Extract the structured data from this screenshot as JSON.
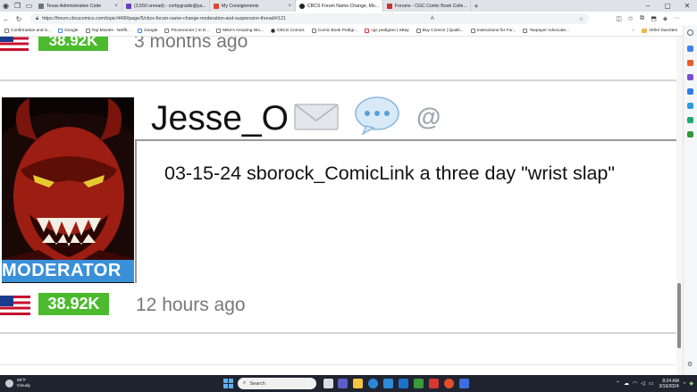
{
  "browser": {
    "tabs": [
      {
        "label": "Texas Administrative Code",
        "fav_color": "#6a7380"
      },
      {
        "label": "(3,550 unread) - corbygradis@ya...",
        "fav_color": "#6a3fb5"
      },
      {
        "label": "My Consignments",
        "fav_color": "#e0462f"
      },
      {
        "label": "CBCS Forum Name Change, Mo...",
        "fav_color": "#222222"
      },
      {
        "label": "Forums - CGC Comic Book Colle...",
        "fav_color": "#c9302c"
      }
    ],
    "url": "https://forum.cbcscomics.com/topic/4490/page/5/cbcs-forum-name-change-moderation-and-suspension-thread/#121",
    "favorites": [
      {
        "label": "Confirmation and S..."
      },
      {
        "label": "Google"
      },
      {
        "label": "Top Movies - Netfli..."
      },
      {
        "label": "Google"
      },
      {
        "label": "Pricenomics | In D..."
      },
      {
        "label": "Mike's Amazing Wo..."
      },
      {
        "label": "CBCS Comics"
      },
      {
        "label": "Comic Book Pedigr..."
      },
      {
        "label": "cgc pedigree | eBay"
      },
      {
        "label": "Buy Comics | Qualit..."
      },
      {
        "label": "Instructions for For..."
      },
      {
        "label": "Taxpayer Advocate..."
      }
    ],
    "other_favorites": "Other favorites"
  },
  "posts": {
    "prev": {
      "rep": "38.92K",
      "time": "3 months ago"
    },
    "current": {
      "username": "Jesse_O",
      "role_badge": "MODERATOR",
      "content": "03-15-24 sborock_ComicLink a three day \"wrist slap\"",
      "rep": "38.92K",
      "time": "12 hours ago",
      "mention_icon": "@"
    }
  },
  "taskbar": {
    "weather_temp": "65°F",
    "weather_desc": "Cloudy",
    "search_placeholder": "Search",
    "time": "8:24 AM",
    "date": "3/16/2024"
  },
  "colors": {
    "rep_green": "#4cba2e",
    "mod_blue": "#3a8fd9",
    "icon_blue": "#5a9fd4"
  }
}
